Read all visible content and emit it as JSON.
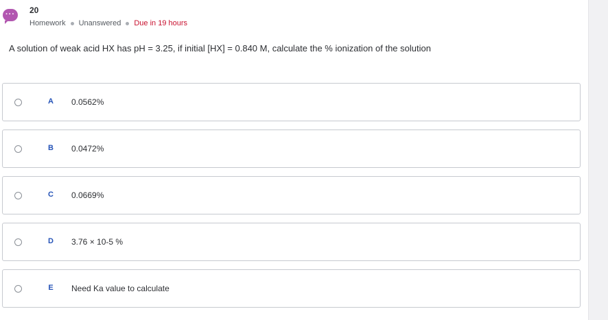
{
  "question": {
    "number": "20",
    "type": "Homework",
    "status": "Unanswered",
    "due": "Due in 19 hours",
    "text": "A solution of weak acid HX has pH = 3.25, if initial [HX] = 0.840 M, calculate the % ionization of the solution"
  },
  "options": [
    {
      "letter": "A",
      "text": "0.0562%"
    },
    {
      "letter": "B",
      "text": "0.0472%"
    },
    {
      "letter": "C",
      "text": "0.0669%"
    },
    {
      "letter": "D",
      "text": "3.76 × 10-5 %"
    },
    {
      "letter": "E",
      "text": "Need Ka value to calculate"
    }
  ],
  "colors": {
    "badge": "#b257b0",
    "due": "#c8102e",
    "letter": "#2553b7"
  },
  "icons": {
    "badge": "speech-bubble-icon",
    "status_separator": "dot-icon",
    "choice": "radio-icon"
  }
}
